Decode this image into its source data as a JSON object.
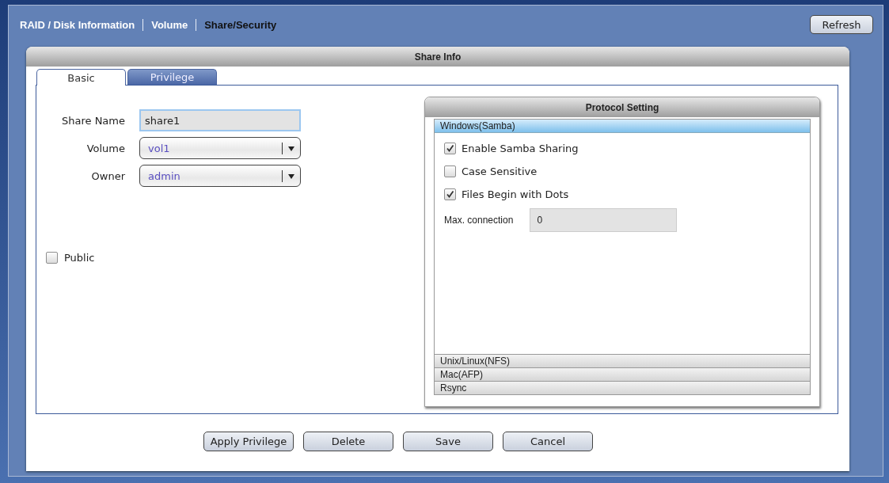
{
  "nav": [
    {
      "label": "RAID / Disk Information",
      "selected": false
    },
    {
      "label": "Volume",
      "selected": false
    },
    {
      "label": "Share/Security",
      "selected": true
    }
  ],
  "refresh_button": "Refresh",
  "panel": {
    "title": "Share Info"
  },
  "tabs": [
    {
      "label": "Basic",
      "selected": true
    },
    {
      "label": "Privilege",
      "selected": false
    }
  ],
  "form": [
    {
      "label": "Share Name",
      "kind": "text",
      "value": "share1"
    },
    {
      "label": "Volume",
      "kind": "select",
      "value": "vol1"
    },
    {
      "label": "Owner",
      "kind": "select",
      "value": "admin"
    }
  ],
  "public": {
    "label": "Public",
    "checked": false
  },
  "protocol": {
    "title": "Protocol Setting",
    "sections": [
      {
        "label": "Windows(Samba)",
        "expanded": true,
        "options": [
          {
            "kind": "checkbox",
            "label": "Enable Samba Sharing",
            "checked": true
          },
          {
            "kind": "checkbox",
            "label": "Case Sensitive",
            "checked": false
          },
          {
            "kind": "checkbox",
            "label": "Files Begin with Dots",
            "checked": true
          },
          {
            "kind": "field",
            "label": "Max. connection",
            "value": "0"
          }
        ]
      },
      {
        "label": "Unix/Linux(NFS)",
        "expanded": false
      },
      {
        "label": "Mac(AFP)",
        "expanded": false
      },
      {
        "label": "Rsync",
        "expanded": false
      }
    ]
  },
  "buttons": [
    "Apply Privilege",
    "Delete",
    "Save",
    "Cancel"
  ]
}
